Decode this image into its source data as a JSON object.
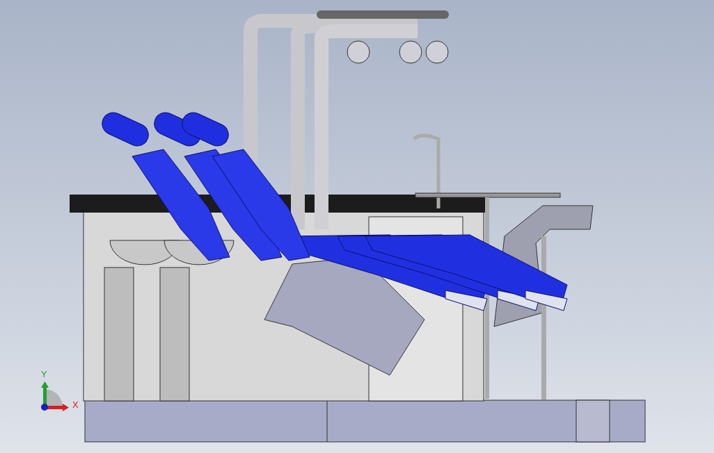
{
  "viewport": {
    "axes": [
      {
        "kind": "vertical",
        "label": "Y",
        "color": "#22a02a"
      },
      {
        "kind": "horizontal",
        "label": "X",
        "color": "#d42020"
      }
    ]
  }
}
